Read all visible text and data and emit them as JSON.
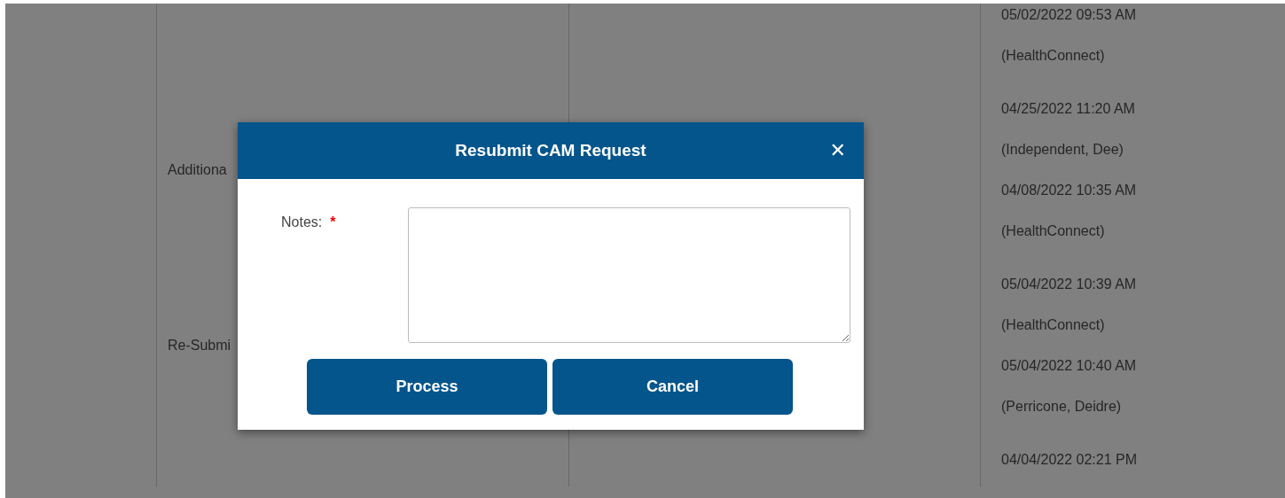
{
  "table": {
    "rows": [
      {
        "column_2": "",
        "column_4": [
          "05/02/2022 09:53 AM",
          "(HealthConnect)"
        ]
      },
      {
        "column_2": "Additiona",
        "column_4": [
          "04/25/2022 11:20 AM",
          "(Independent, Dee)",
          "04/08/2022 10:35 AM",
          "(HealthConnect)"
        ]
      },
      {
        "column_2": "Re-Submi",
        "column_4": [
          "05/04/2022 10:39 AM",
          "(HealthConnect)",
          "05/04/2022 10:40 AM",
          "(Perricone, Deidre)"
        ]
      },
      {
        "column_2": "",
        "column_4": [
          "04/04/2022 02:21 PM"
        ]
      }
    ]
  },
  "dialog": {
    "title": "Resubmit CAM Request",
    "close": "✕",
    "fields": [
      {
        "label": "Notes:",
        "required": true,
        "required_mark": "*",
        "kind": "textarea"
      }
    ],
    "buttons": [
      "Process",
      "Cancel"
    ]
  }
}
